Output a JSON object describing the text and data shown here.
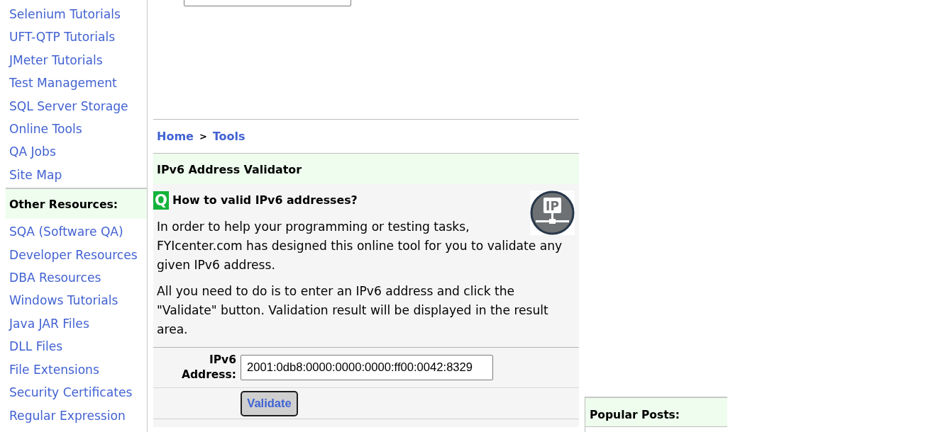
{
  "sidebar": {
    "links": [
      {
        "label": "Selenium Tutorials"
      },
      {
        "label": "UFT-QTP Tutorials"
      },
      {
        "label": "JMeter Tutorials"
      },
      {
        "label": "Test Management"
      },
      {
        "label": "SQL Server Storage"
      },
      {
        "label": "Online Tools"
      },
      {
        "label": "QA Jobs"
      },
      {
        "label": "Site Map"
      }
    ],
    "section_title": "Other Resources:",
    "resource_links": [
      {
        "label": "SQA (Software QA)"
      },
      {
        "label": "Developer Resources"
      },
      {
        "label": "DBA Resources"
      },
      {
        "label": "Windows Tutorials"
      },
      {
        "label": "Java JAR Files"
      },
      {
        "label": "DLL Files"
      },
      {
        "label": "File Extensions"
      },
      {
        "label": "Security Certificates"
      },
      {
        "label": "Regular Expression"
      }
    ]
  },
  "breadcrumb": {
    "items": [
      {
        "label": "Home"
      },
      {
        "label": "Tools"
      }
    ],
    "separator": ">"
  },
  "tool": {
    "title": "IPv6 Address Validator",
    "question": {
      "marker": "Q",
      "text": "How to valid IPv6 addresses?",
      "icon_label": "IP"
    },
    "paragraphs": [
      "In order to help your programming or testing tasks, FYIcenter.com has designed this online tool for you to validate any given IPv6 address.",
      "All you need to do is to enter an IPv6 address and click the \"Validate\" button. Validation result will be displayed in the result area."
    ],
    "form": {
      "label": "IPv6 Address:",
      "value": "2001:0db8:0000:0000:0000:ff00:0042:8329",
      "button": "Validate"
    }
  },
  "popular_posts": {
    "title": "Popular Posts:"
  }
}
